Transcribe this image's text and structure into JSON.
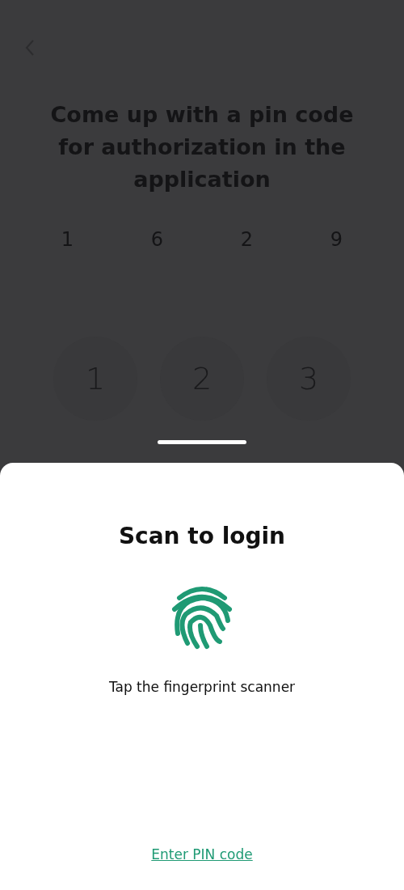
{
  "screen": {
    "title": "Come up with a pin code for authorization in the application",
    "pin_digits": [
      "1",
      "6",
      "2",
      "9"
    ],
    "keypad": [
      "1",
      "2",
      "3"
    ]
  },
  "sheet": {
    "title": "Scan to login",
    "hint": "Tap the fingerprint scanner",
    "link": "Enter PIN code"
  }
}
